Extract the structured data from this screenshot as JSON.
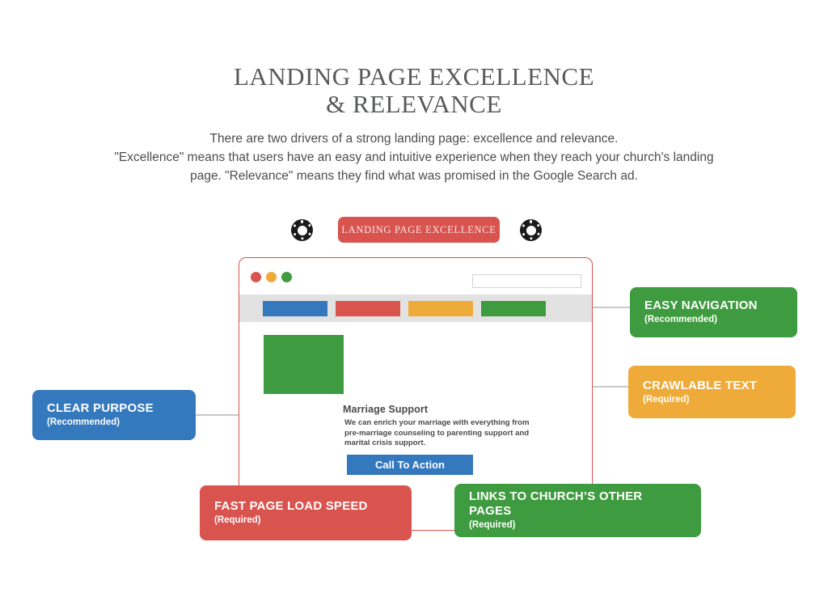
{
  "header": {
    "title_line1": "LANDING PAGE EXCELLENCE",
    "title_line2": "& RELEVANCE",
    "intro_line1": "There are two drivers of a strong landing page: excellence and relevance.",
    "intro_line2": "\"Excellence\" means that users have an easy and intuitive experience when they reach your church's landing",
    "intro_line3": "page. \"Relevance\" means they find what was promised in the Google Search ad."
  },
  "banner": {
    "label": "LANDING PAGE EXCELLENCE",
    "left_icon": "gear-icon",
    "right_icon": "gear-icon",
    "color": "#d9534f"
  },
  "browser": {
    "frame_color": "#d9534f",
    "traffic_lights": [
      {
        "name": "close",
        "color": "#d9534f"
      },
      {
        "name": "minimize",
        "color": "#efab3a"
      },
      {
        "name": "maximize",
        "color": "#3f9b3f"
      }
    ],
    "search": {
      "value": "",
      "placeholder": ""
    },
    "nav_blocks": [
      {
        "name": "nav-block-1",
        "color": "#3478bd"
      },
      {
        "name": "nav-block-2",
        "color": "#d9534f"
      },
      {
        "name": "nav-block-3",
        "color": "#efab3a"
      },
      {
        "name": "nav-block-4",
        "color": "#3f9b3f"
      }
    ],
    "hero_image_color": "#3f9b3f",
    "content": {
      "heading": "Marriage Support",
      "body_line1": "We can enrich your marriage with everything from",
      "body_line2": "pre-marriage counseling to parenting support and",
      "body_line3": "marital crisis support.",
      "cta_label": "Call To Action",
      "cta_color": "#3478bd"
    }
  },
  "callouts": [
    {
      "key": "easy-navigation",
      "title": "EASY NAVIGATION",
      "subtitle": "(Recommended)",
      "color": "#3f9b3f"
    },
    {
      "key": "crawlable-text",
      "title": "CRAWLABLE TEXT",
      "subtitle": "(Required)",
      "color": "#efab3a"
    },
    {
      "key": "clear-purpose",
      "title": "CLEAR PURPOSE",
      "subtitle": "(Recommended)",
      "color": "#3478bd"
    },
    {
      "key": "fast-page-load-speed",
      "title": "FAST PAGE LOAD SPEED",
      "subtitle": "(Required)",
      "color": "#d9534f"
    },
    {
      "key": "links-to-church-other-pages",
      "title": "LINKS TO CHURCH’S OTHER PAGES",
      "subtitle": "(Required)",
      "color": "#3f9b3f"
    }
  ]
}
